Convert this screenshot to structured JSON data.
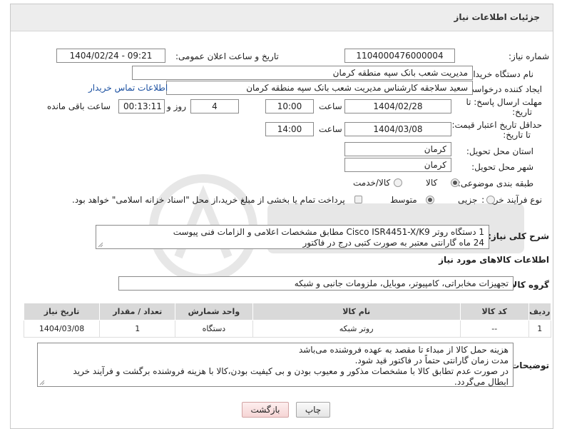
{
  "header": {
    "title": "جزئیات اطلاعات نیاز"
  },
  "fields": {
    "need_number_label": "شماره نیاز:",
    "need_number": "1104000476000004",
    "announce_label": "تاریخ و ساعت اعلان عمومی:",
    "announce_value": "1404/02/24 - 09:21",
    "buyer_org_label": "نام دستگاه خریدار:",
    "buyer_org": "مدیریت شعب بانک سپه منطقه کرمان",
    "requester_label": "ایجاد کننده درخواست:",
    "requester": "سعید سلاجقه کارشناس مدیریت شعب بانک سپه منطقه کرمان",
    "contact_link": "اطلاعات تماس خریدار",
    "deadline_label_1": "مهلت ارسال پاسخ: تا",
    "deadline_label_2": "تاریخ:",
    "deadline_date": "1404/02/28",
    "time_label": "ساعت",
    "deadline_time": "10:00",
    "days_value": "4",
    "days_label": "روز و",
    "remaining_value": "00:13:11",
    "remaining_label": "ساعت باقی مانده",
    "validity_label_1": "حداقل تاریخ اعتبار قیمت:",
    "validity_label_2": "تا تاریخ:",
    "validity_date": "1404/03/08",
    "validity_time": "14:00",
    "province_label": "استان محل تحویل:",
    "province": "کرمان",
    "city_label": "شهر محل تحویل:",
    "city": "کرمان",
    "category_label": "طبقه بندی موضوعی:",
    "category_options": [
      "کالا",
      "کالا/خدمت"
    ],
    "purchase_type_label": "نوع فرآیند خرید :",
    "purchase_options": [
      "جزیی",
      "متوسط"
    ],
    "payment_note": "پرداخت تمام یا بخشی از مبلغ خرید،از محل \"اسناد خزانه اسلامی\" خواهد بود."
  },
  "description": {
    "label": "شرح کلی نیاز:",
    "line1": "1 دستگاه روتر Cisco ISR4451-X/K9 مطابق مشخصات اعلامی و الزامات فنی پیوست",
    "line2": "24 ماه گارانتی معتبر به صورت کتبی درج در فاکتور"
  },
  "goods": {
    "section_title": "اطلاعات کالاهای مورد نیاز",
    "group_label": "گروه کالا:",
    "group_value": "تجهیزات مخابراتی، کامپیوتر، موبایل، ملزومات جانبی و شبکه",
    "columns": [
      "ردیف",
      "کد کالا",
      "نام کالا",
      "واحد شمارش",
      "تعداد / مقدار",
      "تاریخ نیاز"
    ],
    "rows": [
      [
        "1",
        "--",
        "روتر شبکه",
        "دستگاه",
        "1",
        "1404/03/08"
      ]
    ]
  },
  "buyer_notes": {
    "label": "توضیحات خریدار:",
    "lines": [
      "هزینه حمل کالا از مبداء تا مقصد به عهده فروشنده می‌باشد",
      "مدت زمان گارانتی حتماً در فاکتور قید شود.",
      "در صورت عدم تطابق کالا با مشخصات مذکور و معیوب بودن و بی کیفیت بودن،کالا با هزینه فروشنده برگشت و فرآیند خرید",
      "ابطال می‌گردد."
    ]
  },
  "buttons": {
    "print": "چاپ",
    "back": "بازگشت"
  },
  "colors": {
    "link": "#1a4fa0",
    "header_bg": "#ededed",
    "table_head": "#d9d9d9"
  }
}
